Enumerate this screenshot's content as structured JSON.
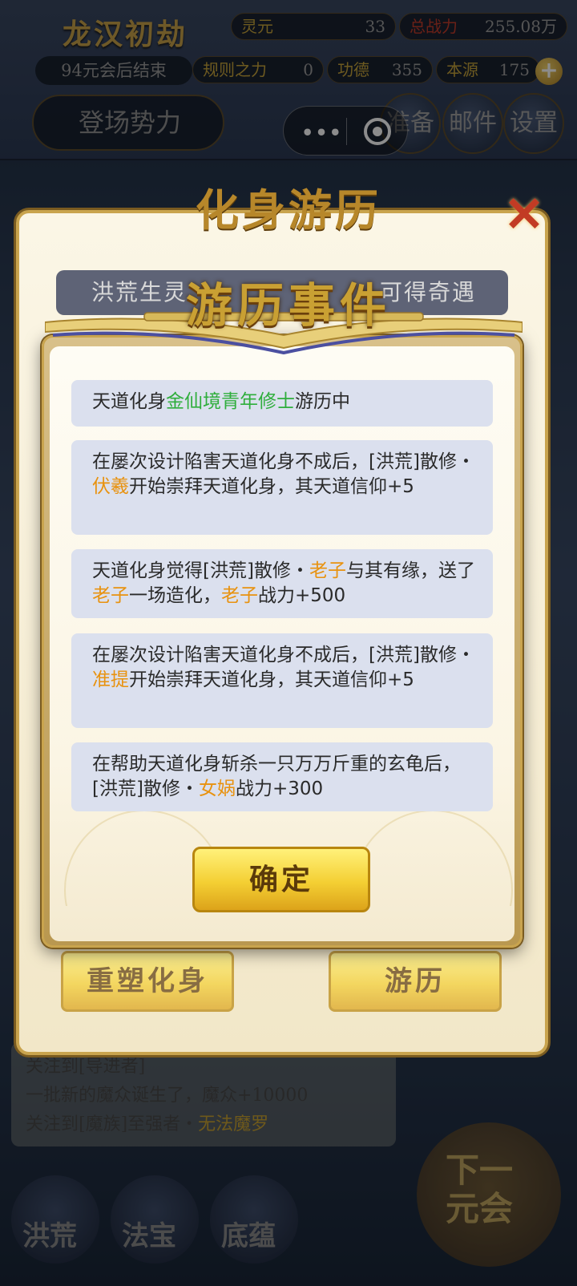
{
  "background": {
    "era_title": "龙汉初劫",
    "era_end": "94元会后结束",
    "stats": {
      "lingyuan": {
        "label": "灵元",
        "value": "33"
      },
      "power": {
        "label": "总战力",
        "value": "255.08万"
      },
      "rule_power": {
        "label": "规则之力",
        "value": "0"
      },
      "merit": {
        "label": "功德",
        "value": "355"
      },
      "origin": {
        "label": "本源",
        "value": "175"
      }
    },
    "plus_label": "+",
    "faction_button": "登场势力",
    "icons": [
      "准备",
      "邮件",
      "设置"
    ],
    "log_lines": [
      {
        "prefix": "关注到[导进者]",
        "suffix": "一批新的魔众诞生了，魔众+10000"
      },
      {
        "text": "一批新的魔众诞生了，魔众+10000"
      },
      {
        "prefix": "关注到[魔族]至强者・",
        "name": "无法魔罗"
      }
    ],
    "bottom_nav": [
      "洪荒",
      "法宝",
      "底蕴"
    ],
    "next_era": [
      "下一",
      "元会"
    ]
  },
  "wechat_capsule": {
    "more": "•••",
    "close": "◉"
  },
  "travel_modal": {
    "title": "化身游历",
    "banner_left": "洪荒生灵",
    "banner_right": "可得奇遇",
    "close": "✕",
    "reshape_button": "重塑化身",
    "travel_button": "游历"
  },
  "event_modal": {
    "title": "游历事件",
    "events": [
      {
        "parts": [
          {
            "t": "天道化身"
          },
          {
            "t": "金仙境青年修士",
            "c": "green"
          },
          {
            "t": "游历中"
          }
        ]
      },
      {
        "parts": [
          {
            "t": "在屡次设计陷害天道化身不成后，[洪荒]散修・"
          },
          {
            "t": "伏羲",
            "c": "gold"
          },
          {
            "t": "开始崇拜天道化身，其天道信仰+5"
          }
        ]
      },
      {
        "parts": [
          {
            "t": "天道化身觉得[洪荒]散修・"
          },
          {
            "t": "老子",
            "c": "gold"
          },
          {
            "t": "与其有缘，送了"
          },
          {
            "t": "老子",
            "c": "gold"
          },
          {
            "t": "一场造化，"
          },
          {
            "t": "老子",
            "c": "gold"
          },
          {
            "t": "战力+500"
          }
        ]
      },
      {
        "parts": [
          {
            "t": "在屡次设计陷害天道化身不成后，[洪荒]散修・"
          },
          {
            "t": "准提",
            "c": "gold"
          },
          {
            "t": "开始崇拜天道化身，其天道信仰+5"
          }
        ]
      },
      {
        "parts": [
          {
            "t": "在帮助天道化身斩杀一只万万斤重的玄龟后，[洪荒]散修・"
          },
          {
            "t": "女娲",
            "c": "gold"
          },
          {
            "t": "战力+300"
          }
        ]
      }
    ],
    "confirm_button": "确定"
  },
  "colors": {
    "highlight_gold": "#e8920f",
    "highlight_green": "#2fae3c",
    "card_bg": "#dbe0ee",
    "button_gold": "#f4cf33"
  }
}
